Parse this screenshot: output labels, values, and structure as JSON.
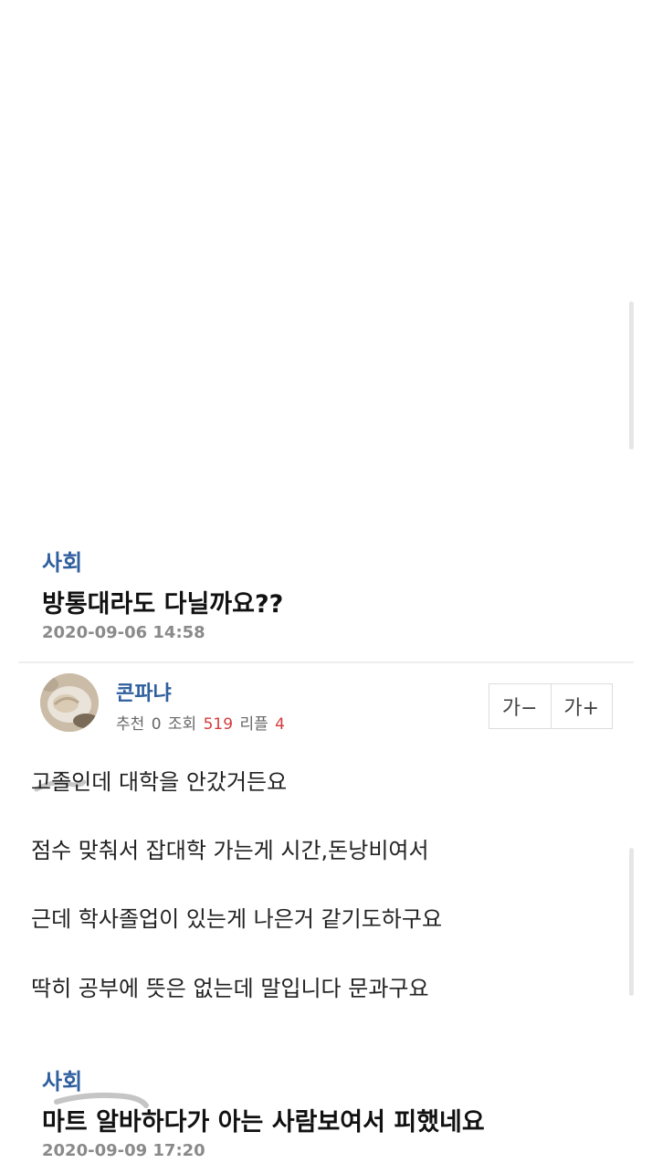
{
  "post1": {
    "category": "사회",
    "title": "방통대라도 다닐까요??",
    "date": "2020-09-06 14:58"
  },
  "author": {
    "name": "콘파냐",
    "recommend_label": "추천",
    "recommend_count": "0",
    "views_label": "조회",
    "views_count": "519",
    "replies_label": "리플",
    "replies_count": "4"
  },
  "font_controls": {
    "decrease_label": "가−",
    "increase_label": "가+"
  },
  "body_lines": [
    "고졸인데 대학을 안갔거든요",
    "점수 맞춰서 잡대학 가는게 시간,돈낭비여서",
    "근데 학사졸업이 있는게 나은거 같기도하구요",
    "딱히 공부에 뜻은 없는데 말입니다 문과구요"
  ],
  "post2": {
    "category": "사회",
    "title": "마트 알바하다가 아는 사람보여서 피했네요",
    "date": "2020-09-09 17:20"
  },
  "colors": {
    "category_blue": "#2f5f9e",
    "count_red": "#d43c3c",
    "date_gray": "#8a8a8a"
  }
}
